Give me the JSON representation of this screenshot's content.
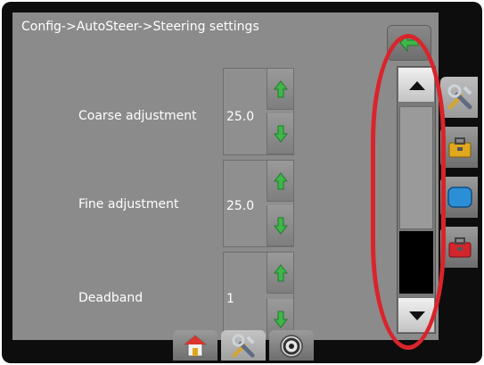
{
  "header": {
    "breadcrumb": "Config->AutoSteer->Steering settings"
  },
  "settings": [
    {
      "label": "Coarse adjustment",
      "value": "25.0"
    },
    {
      "label": "Fine adjustment",
      "value": "25.0"
    },
    {
      "label": "Deadband",
      "value": "1"
    }
  ],
  "icons": {
    "back": "back-arrow-icon",
    "increase": "green-up-arrow-icon",
    "decrease": "green-down-arrow-icon",
    "scroll_up": "triangle-up-icon",
    "scroll_down": "triangle-down-icon",
    "side_tabs": [
      "tools-icon",
      "toolbox-icon",
      "display-icon",
      "red-toolbox-icon"
    ],
    "bottom_tabs": [
      "home-icon",
      "tools-icon",
      "gauge-icon"
    ]
  },
  "colors": {
    "screen_bg": "#8b8b8b",
    "arrow_green": "#3fb54a",
    "highlight": "#d9242b",
    "scroll_thumb": "#000000"
  }
}
